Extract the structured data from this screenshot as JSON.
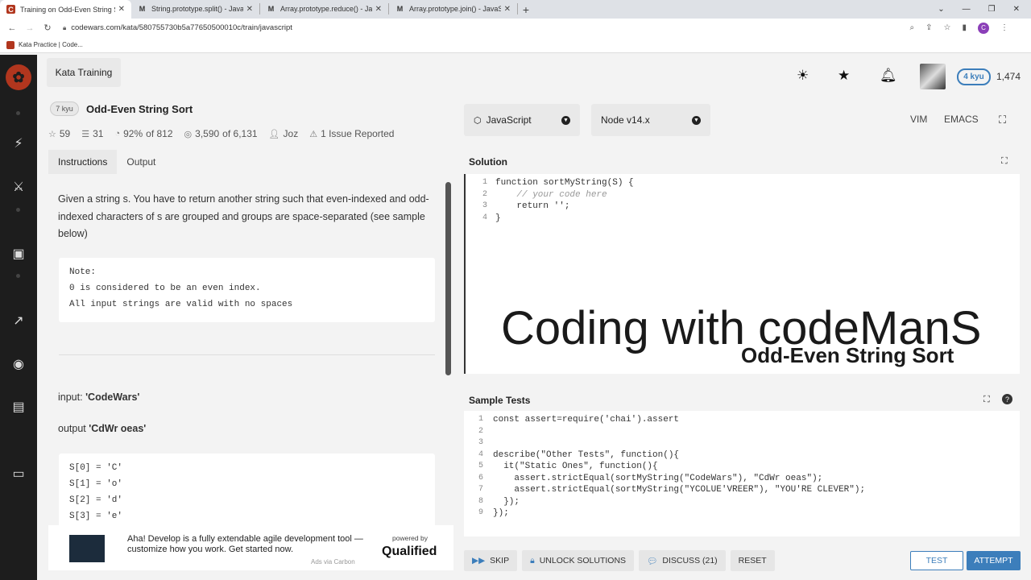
{
  "browser": {
    "tabs": [
      {
        "title": "Training on Odd-Even String Sor",
        "icon": "codewars-icon",
        "active": true
      },
      {
        "title": "String.prototype.split() - JavaScrip",
        "icon": "mdn-icon",
        "active": false
      },
      {
        "title": "Array.prototype.reduce() - JavaSc",
        "icon": "mdn-icon",
        "active": false
      },
      {
        "title": "Array.prototype.join() - JavaScrip",
        "icon": "mdn-icon",
        "active": false
      }
    ],
    "url": "codewars.com/kata/580755730b5a77650500010c/train/javascript",
    "profile_initial": "C",
    "bookmark": "Kata Practice | Code..."
  },
  "topbar": {
    "section": "Kata Training",
    "rank": "4 kyu",
    "honor": "1,474"
  },
  "kata": {
    "kyu": "7 kyu",
    "title": "Odd-Even String Sort",
    "stats": {
      "stars": "59",
      "collections": "31",
      "satisfaction": "92%",
      "satisfaction_of": "of 812",
      "completed": "3,590",
      "completed_of": "of 6,131",
      "author": "Joz",
      "issues": "1 Issue Reported"
    },
    "tabs": [
      "Instructions",
      "Output"
    ]
  },
  "instructions": {
    "p1": "Given a string s. You have to return another string such that even-indexed and odd-indexed characters of s are grouped and groups are space-separated (see sample below)",
    "note_lines": [
      "Note:",
      "0 is considered to be an even index.",
      "All input strings are valid with no spaces"
    ],
    "input_label": "input:",
    "input_value": "'CodeWars'",
    "output_label": "output",
    "output_value": "'CdWr oeas'",
    "sample_lines": [
      "S[0] = 'C'",
      "S[1] = 'o'",
      "S[2] = 'd'",
      "S[3] = 'e'"
    ]
  },
  "ad": {
    "text": "Aha! Develop is a fully extendable agile development tool — customize how you work. Get started now.",
    "carbon": "Ads via Carbon",
    "powered": "powered by",
    "brand": "Qualified"
  },
  "editor": {
    "language": "JavaScript",
    "version": "Node v14.x",
    "modes": [
      "VIM",
      "EMACS"
    ],
    "solution_label": "Solution",
    "solution_lines": [
      "function sortMyString(S) {",
      "    // your code here",
      "    return '';",
      "}"
    ],
    "overlay_title": "Coding with codeManS",
    "overlay_subtitle": "Odd-Even String Sort",
    "tests_label": "Sample Tests",
    "test_lines": [
      "const assert=require('chai').assert",
      "",
      "",
      "describe(\"Other Tests\", function(){",
      "  it(\"Static Ones\", function(){",
      "    assert.strictEqual(sortMyString(\"CodeWars\"), \"CdWr oeas\");",
      "    assert.strictEqual(sortMyString(\"YCOLUE'VREER\"), \"YOU'RE CLEVER\");",
      "  });",
      "});"
    ]
  },
  "actions": {
    "skip": "SKIP",
    "unlock": "UNLOCK SOLUTIONS",
    "discuss": "DISCUSS (21)",
    "reset": "RESET",
    "test": "TEST",
    "attempt": "ATTEMPT"
  },
  "colors": {
    "accent": "#3c7ebb",
    "sidebar": "#1d1d1d",
    "brand": "#b1361e"
  }
}
